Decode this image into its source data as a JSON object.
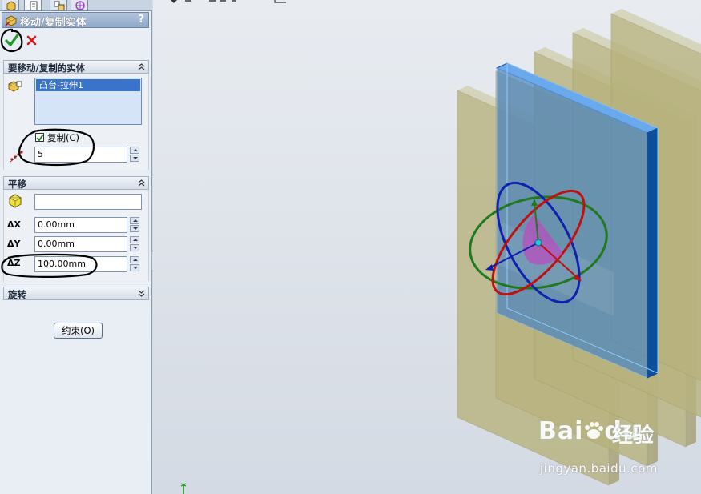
{
  "panel": {
    "title": "移动/复制实体",
    "help": "?",
    "bodies_group": {
      "header": "要移动/复制的实体",
      "selected_body": "凸台-拉伸1",
      "copy_label": "复制(C)",
      "copy_checked": true,
      "copy_count": "5"
    },
    "translate_group": {
      "header": "平移",
      "reference_value": "",
      "dx_label": "X",
      "dx_value": "0.00mm",
      "dy_label": "Y",
      "dy_value": "0.00mm",
      "dz_label": "Z",
      "dz_value": "100.00mm"
    },
    "rotate_group": {
      "header": "旋转"
    },
    "constraints_button": "约束(O)"
  },
  "watermark": {
    "logo": "Bai",
    "logo2": "du",
    "jingyan": "经验",
    "url": "jingyan.baidu.com"
  },
  "colors": {
    "selected_body": "#1f6fd1",
    "preview_copies": "#b8b37e",
    "panel_header": "#8fa8c8",
    "annotation": "#000000"
  }
}
